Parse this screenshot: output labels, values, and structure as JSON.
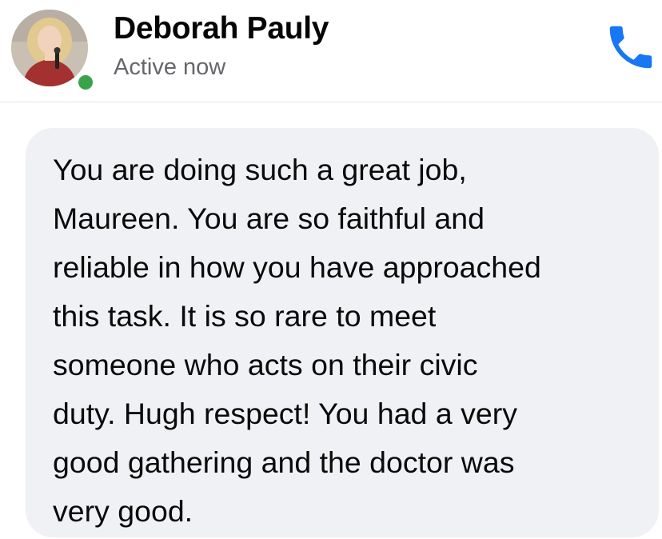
{
  "contact": {
    "name": "Deborah Pauly",
    "status": "Active now"
  },
  "icons": {
    "call": "phone-icon",
    "presence": "online-dot",
    "avatar": "profile-photo"
  },
  "colors": {
    "call_icon": "#1877f2",
    "presence": "#3aa34a",
    "bubble_bg": "#f0f1f4",
    "status_text": "#65676b"
  },
  "message": {
    "lines": [
      "You are doing such a great job,",
      "Maureen. You are so faithful and",
      "reliable in how you have approached",
      "this task. It is so rare to meet",
      "someone who acts on their civic",
      "duty. Hugh respect! You had a very",
      "good gathering and the doctor was",
      "very good."
    ]
  }
}
